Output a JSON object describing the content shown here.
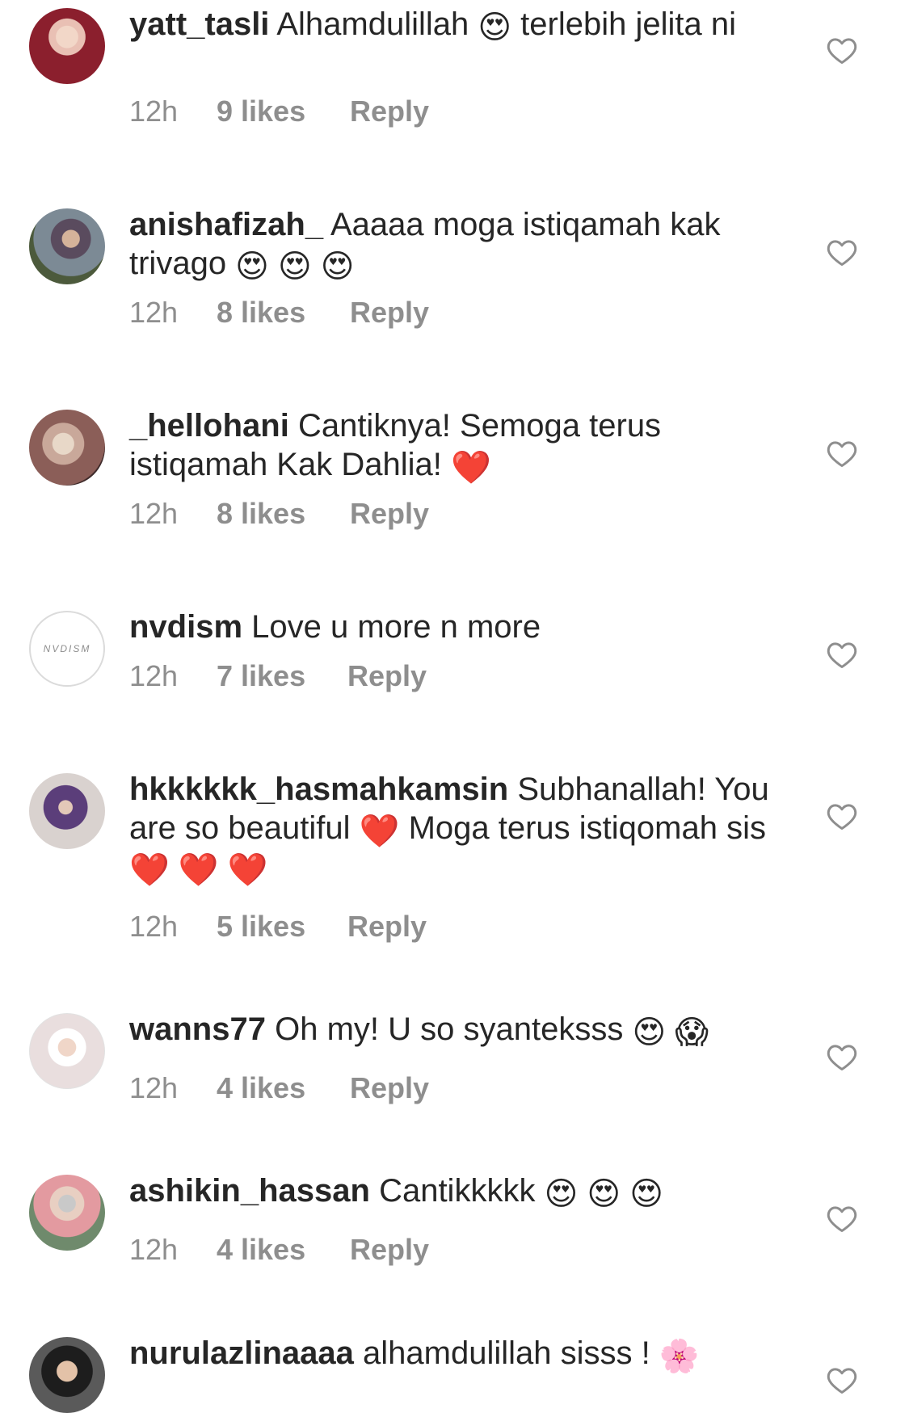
{
  "comments": [
    {
      "username": "yatt_tasli",
      "text_parts": [
        "Alhamdulillah ",
        " terlebih jelita ni"
      ],
      "emojis": [
        "😍"
      ],
      "time": "12h",
      "likes": "9 likes",
      "reply": "Reply"
    },
    {
      "username": "anishafizah_",
      "text": "Aaaaa moga istiqamah kak trivago ",
      "emojis": "😍 😍 😍",
      "time": "12h",
      "likes": "8 likes",
      "reply": "Reply"
    },
    {
      "username": "_hellohani",
      "text": "Cantiknya! Semoga terus istiqamah Kak Dahlia! ",
      "emojis": "❤️",
      "time": "12h",
      "likes": "8 likes",
      "reply": "Reply"
    },
    {
      "username": "nvdism",
      "text": "Love u more n more",
      "avatar_text": "NVDISM",
      "time": "12h",
      "likes": "7 likes",
      "reply": "Reply"
    },
    {
      "username": "hkkkkkk_hasmahkamsin",
      "text_parts": [
        "Subhanallah! You are so beautiful ",
        " Moga terus istiqomah sis "
      ],
      "emojis": [
        "❤️",
        "❤️ ❤️ ❤️"
      ],
      "time": "12h",
      "likes": "5 likes",
      "reply": "Reply"
    },
    {
      "username": "wanns77",
      "text": "Oh my! U so syanteksss ",
      "emojis": "😍 😱",
      "time": "12h",
      "likes": "4 likes",
      "reply": "Reply"
    },
    {
      "username": "ashikin_hassan",
      "text": "Cantikkkkk ",
      "emojis": "😍 😍 😍",
      "time": "12h",
      "likes": "4 likes",
      "reply": "Reply"
    },
    {
      "username": "nurulazlinaaaa",
      "text": "alhamdulillah sisss ! ",
      "emojis": "🌸"
    }
  ],
  "icons": {
    "like": "heart-outline-icon"
  },
  "colors": {
    "text": "#262626",
    "meta": "#8e8e8e",
    "icon": "#8e8e8e"
  }
}
